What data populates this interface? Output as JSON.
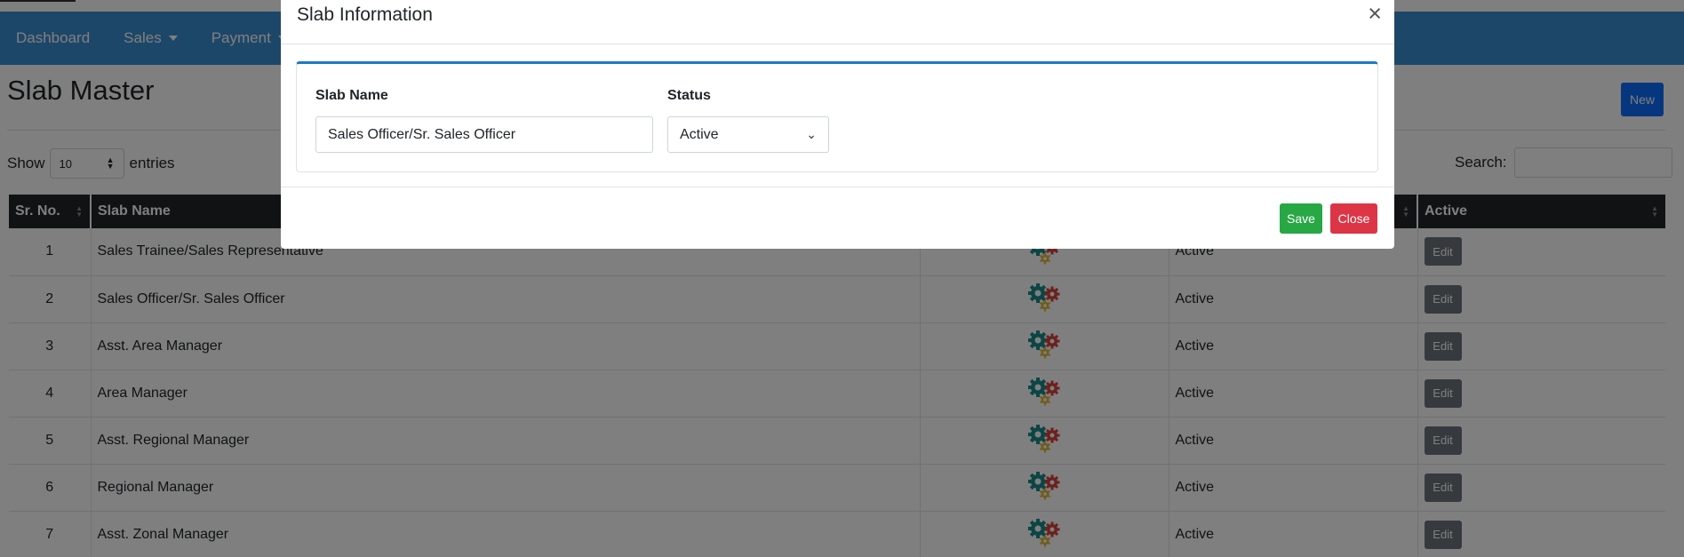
{
  "nav": {
    "items": [
      {
        "label": "Dashboard"
      },
      {
        "label": "Sales",
        "dropdown": true
      },
      {
        "label": "Payment",
        "dropdown": true
      }
    ]
  },
  "page": {
    "title": "Slab Master",
    "new_label": "New",
    "show_label": "Show",
    "entries_label": "entries",
    "page_length": "10",
    "search_label": "Search:"
  },
  "table": {
    "headers": [
      "Sr. No.",
      "Slab Name",
      "",
      "",
      "Active"
    ],
    "rows": [
      {
        "sr": "1",
        "name": "Sales Trainee/Sales Representative",
        "status": "Active",
        "action": "Edit"
      },
      {
        "sr": "2",
        "name": "Sales Officer/Sr. Sales Officer",
        "status": "Active",
        "action": "Edit"
      },
      {
        "sr": "3",
        "name": "Asst. Area Manager",
        "status": "Active",
        "action": "Edit"
      },
      {
        "sr": "4",
        "name": "Area Manager",
        "status": "Active",
        "action": "Edit"
      },
      {
        "sr": "5",
        "name": "Asst. Regional Manager",
        "status": "Active",
        "action": "Edit"
      },
      {
        "sr": "6",
        "name": "Regional Manager",
        "status": "Active",
        "action": "Edit"
      },
      {
        "sr": "7",
        "name": "Asst. Zonal Manager",
        "status": "Active",
        "action": "Edit"
      }
    ],
    "row_icon": "gears-icon"
  },
  "modal": {
    "title": "Slab Information",
    "close_symbol": "×",
    "slab_name_label": "Slab Name",
    "slab_name_value": "Sales Officer/Sr. Sales Officer",
    "status_label": "Status",
    "status_value": "Active",
    "save_label": "Save",
    "close_label": "Close"
  },
  "colors": {
    "navbar": "#3a8ed3",
    "primary": "#0d6efd",
    "success": "#28a745",
    "danger": "#dc3545",
    "secondary": "#6c757d",
    "table_header": "#212529"
  }
}
